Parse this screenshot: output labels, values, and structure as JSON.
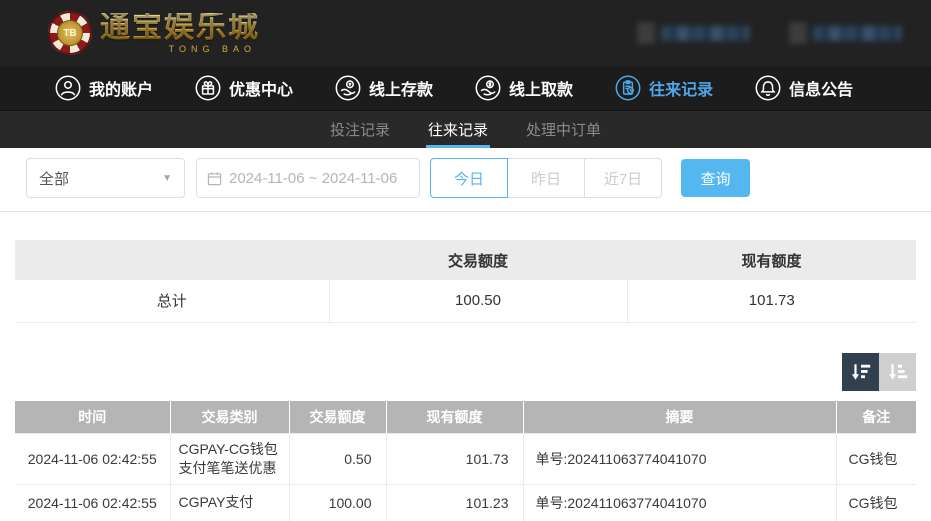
{
  "header": {
    "brand": {
      "chip_text": "TB",
      "title": "通宝娱乐城",
      "subtitle": "TONG BAO"
    }
  },
  "nav": {
    "items": [
      {
        "label": "我的账户",
        "icon": "user-icon",
        "active": false
      },
      {
        "label": "优惠中心",
        "icon": "gift-icon",
        "active": false
      },
      {
        "label": "线上存款",
        "icon": "deposit-icon",
        "active": false
      },
      {
        "label": "线上取款",
        "icon": "withdraw-icon",
        "active": false
      },
      {
        "label": "往来记录",
        "icon": "records-icon",
        "active": true
      },
      {
        "label": "信息公告",
        "icon": "bell-icon",
        "active": false
      }
    ]
  },
  "subnav": {
    "tabs": [
      {
        "label": "投注记录",
        "active": false
      },
      {
        "label": "往来记录",
        "active": true
      },
      {
        "label": "处理中订单",
        "active": false
      }
    ]
  },
  "filters": {
    "type_select": {
      "value": "全部"
    },
    "date_range": {
      "value": "2024-11-06 ~ 2024-11-06"
    },
    "quick_buttons": [
      {
        "label": "今日",
        "active": true
      },
      {
        "label": "昨日",
        "active": false
      },
      {
        "label": "近7日",
        "active": false
      }
    ],
    "query_label": "查询"
  },
  "summary": {
    "columns": [
      "",
      "交易额度",
      "现有额度"
    ],
    "row": {
      "label": "总计",
      "transaction_amount": "100.50",
      "current_balance": "101.73"
    }
  },
  "table": {
    "columns": [
      "时间",
      "交易类别",
      "交易额度",
      "现有额度",
      "摘要",
      "备注"
    ],
    "rows": [
      {
        "time": "2024-11-06 02:42:55",
        "type": "CGPAY-CG钱包支付笔笔送优惠",
        "amount": "0.50",
        "balance": "101.73",
        "summary": "单号:202411063774041070",
        "note": "CG钱包"
      },
      {
        "time": "2024-11-06 02:42:55",
        "type": "CGPAY支付",
        "amount": "100.00",
        "balance": "101.23",
        "summary": "单号:202411063774041070",
        "note": "CG钱包"
      }
    ]
  },
  "colors": {
    "accent_blue": "#55b7f0",
    "nav_active_blue": "#4da7e8",
    "header_bg": "#222222",
    "nav_bg": "#1c1c1c",
    "subnav_bg": "#292929",
    "table_header_bg": "#b5b5b5",
    "summary_header_bg": "#ebebeb",
    "sort_active_bg": "#31404f",
    "sort_inactive_bg": "#cfcfcf",
    "brand_gold": "#d8a73c"
  }
}
